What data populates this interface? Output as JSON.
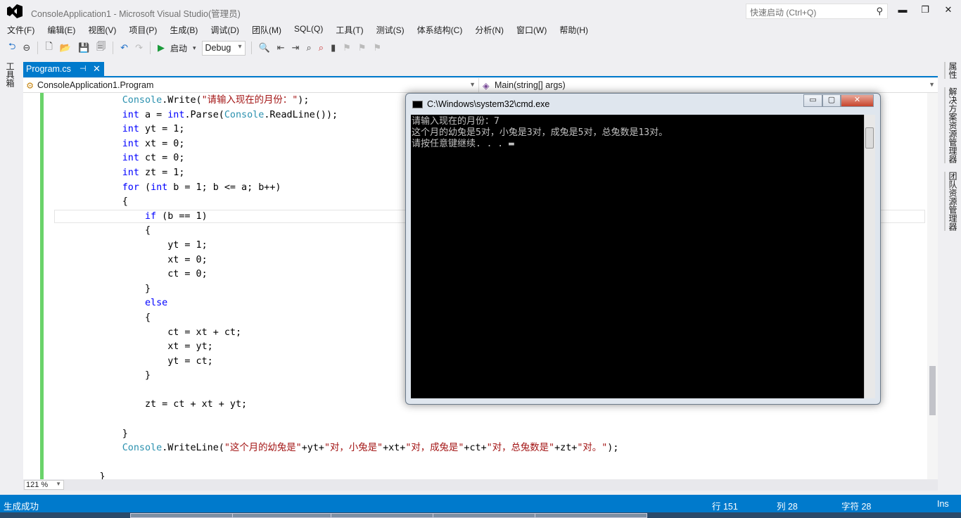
{
  "window": {
    "title": "ConsoleApplication1 - Microsoft Visual Studio(管理员)",
    "quick_launch_placeholder": "快速启动 (Ctrl+Q)",
    "minimize": "▬",
    "restore": "❐",
    "close": "✕"
  },
  "menu": [
    "文件(F)",
    "编辑(E)",
    "视图(V)",
    "项目(P)",
    "生成(B)",
    "调试(D)",
    "团队(M)",
    "SQL(Q)",
    "工具(T)",
    "测试(S)",
    "体系结构(C)",
    "分析(N)",
    "窗口(W)",
    "帮助(H)"
  ],
  "toolbar": {
    "start_label": "启动",
    "config": "Debug"
  },
  "left_tabs": {
    "toolbox": "工具箱"
  },
  "right_tabs": [
    "属性",
    "解决方案资源管理器",
    "团队资源管理器"
  ],
  "document_tab": {
    "label": "Program.cs",
    "pin": "⊣",
    "close": "✕"
  },
  "nav": {
    "class": "ConsoleApplication1.Program",
    "member": "Main(string[] args)"
  },
  "code_lines": [
    [
      [
        "",
        "            "
      ],
      [
        "ty",
        "Console"
      ],
      [
        "",
        ".Write("
      ],
      [
        "st",
        "\"请输入现在的月份：\""
      ],
      [
        "",
        ");"
      ]
    ],
    [
      [
        "",
        "            "
      ],
      [
        "kw",
        "int"
      ],
      [
        "",
        " a = "
      ],
      [
        "kw",
        "int"
      ],
      [
        "",
        ".Parse("
      ],
      [
        "ty",
        "Console"
      ],
      [
        "",
        ".ReadLine());"
      ]
    ],
    [
      [
        "",
        "            "
      ],
      [
        "kw",
        "int"
      ],
      [
        "",
        " yt = 1;"
      ]
    ],
    [
      [
        "",
        "            "
      ],
      [
        "kw",
        "int"
      ],
      [
        "",
        " xt = 0;"
      ]
    ],
    [
      [
        "",
        "            "
      ],
      [
        "kw",
        "int"
      ],
      [
        "",
        " ct = 0;"
      ]
    ],
    [
      [
        "",
        "            "
      ],
      [
        "kw",
        "int"
      ],
      [
        "",
        " zt = 1;"
      ]
    ],
    [
      [
        "",
        "            "
      ],
      [
        "kw",
        "for"
      ],
      [
        "",
        " ("
      ],
      [
        "kw",
        "int"
      ],
      [
        "",
        " b = 1; b <= a; b++)"
      ]
    ],
    [
      [
        "",
        "            {"
      ]
    ],
    [
      [
        "",
        "                "
      ],
      [
        "kw",
        "if"
      ],
      [
        "",
        " (b == 1)"
      ]
    ],
    [
      [
        "",
        "                {"
      ]
    ],
    [
      [
        "",
        "                    yt = 1;"
      ]
    ],
    [
      [
        "",
        "                    xt = 0;"
      ]
    ],
    [
      [
        "",
        "                    ct = 0;"
      ]
    ],
    [
      [
        "",
        "                }"
      ]
    ],
    [
      [
        "",
        "                "
      ],
      [
        "kw",
        "else"
      ]
    ],
    [
      [
        "",
        "                {"
      ]
    ],
    [
      [
        "",
        "                    ct = xt + ct;"
      ]
    ],
    [
      [
        "",
        "                    xt = yt;"
      ]
    ],
    [
      [
        "",
        "                    yt = ct;"
      ]
    ],
    [
      [
        "",
        "                }"
      ]
    ],
    [
      [
        "",
        ""
      ]
    ],
    [
      [
        "",
        "                zt = ct + xt + yt;"
      ]
    ],
    [
      [
        "",
        ""
      ]
    ],
    [
      [
        "",
        "            }"
      ]
    ],
    [
      [
        "",
        "            "
      ],
      [
        "ty",
        "Console"
      ],
      [
        "",
        ".WriteLine("
      ],
      [
        "st",
        "\"这个月的幼兔是\""
      ],
      [
        "",
        "+yt+"
      ],
      [
        "st",
        "\"对，小兔是\""
      ],
      [
        "",
        "+xt+"
      ],
      [
        "st",
        "\"对，成兔是\""
      ],
      [
        "",
        "+ct+"
      ],
      [
        "st",
        "\"对，总兔数是\""
      ],
      [
        "",
        "+zt+"
      ],
      [
        "st",
        "\"对。\""
      ],
      [
        "",
        ");"
      ]
    ],
    [
      [
        "",
        ""
      ]
    ],
    [
      [
        "",
        "        }"
      ]
    ]
  ],
  "zoom": "121 %",
  "status": {
    "message": "生成成功",
    "line": "行 151",
    "col": "列 28",
    "char": "字符 28",
    "mode": "Ins"
  },
  "cmd": {
    "title": "C:\\Windows\\system32\\cmd.exe",
    "output": [
      "请输入现在的月份：7",
      "这个月的幼兔是5对，小兔是3对，成兔是5对，总兔数是13对。",
      "请按任意键继续. . . ▬"
    ]
  },
  "colors": {
    "accent": "#007acc",
    "keyword": "#0000ff",
    "type": "#2b91af",
    "string": "#a31515"
  }
}
